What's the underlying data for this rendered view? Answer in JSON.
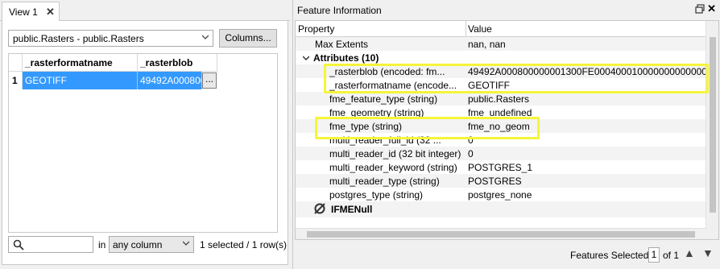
{
  "left": {
    "tab_label": "View 1",
    "tab_close": "✕",
    "table_select_value": "public.Rasters - public.Rasters",
    "columns_button": "Columns...",
    "grid": {
      "columns": [
        "_rasterformatname",
        "_rasterblob"
      ],
      "rows": [
        {
          "row_num": "1",
          "cells": [
            "GEOTIFF",
            "49492A0008000..."
          ]
        }
      ],
      "more_button": "..."
    },
    "search_placeholder": "",
    "in_label": "in",
    "scope_value": "any column",
    "selection_status": "1 selected / 1 row(s)"
  },
  "right": {
    "panel_title": "Feature Information",
    "close_glyph": "✕",
    "headers": {
      "property": "Property",
      "value": "Value"
    },
    "rows": [
      {
        "property": "Max Extents",
        "value": "nan, nan"
      },
      {
        "property": "Attributes (10)",
        "value": "",
        "group": true
      },
      {
        "property": "_rasterblob (encoded: fm...",
        "value": "49492A000800000001300FE00040001000000000000000000010"
      },
      {
        "property": "_rasterformatname (encode...",
        "value": "GEOTIFF"
      },
      {
        "property": "fme_feature_type (string)",
        "value": "public.Rasters"
      },
      {
        "property": "fme_geometry (string)",
        "value": "fme_undefined"
      },
      {
        "property": "fme_type (string)",
        "value": "fme_no_geom"
      },
      {
        "property": "multi_reader_full_id (32 ...",
        "value": "0"
      },
      {
        "property": "multi_reader_id (32 bit integer)",
        "value": "0"
      },
      {
        "property": "multi_reader_keyword (string)",
        "value": "POSTGRES_1"
      },
      {
        "property": "multi_reader_type (string)",
        "value": "POSTGRES"
      },
      {
        "property": "postgres_type (string)",
        "value": "postgres_none"
      },
      {
        "property": "IFMENull",
        "value": "",
        "null_geom": true
      }
    ],
    "footer": {
      "features_selected_label": "Features Selected:",
      "page_current": "1",
      "page_of": "of 1",
      "nav_up": "▲",
      "nav_down": "▼"
    },
    "highlight_color": "#f5f53a",
    "selection_color": "#3399ff"
  }
}
